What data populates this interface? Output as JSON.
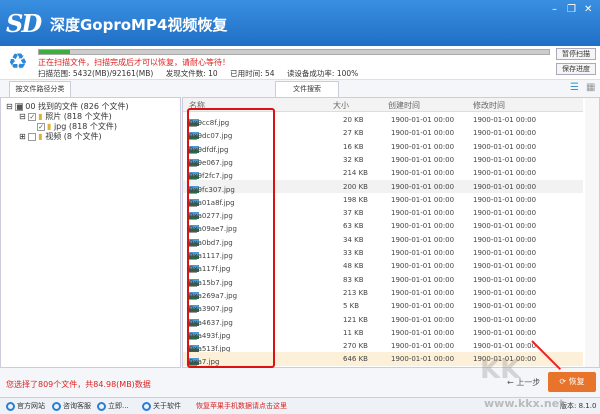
{
  "app": {
    "logo": "SD",
    "title": "深度GoproMP4视频恢复"
  },
  "scan": {
    "progress": 0.06,
    "message": "正在扫描文件，扫描完成后才可以恢复，请耐心等待！",
    "range": "扫描范围: 5432(MB)/92161(MB)",
    "found": "发现文件数: 10",
    "elapsed": "已用时间: 54",
    "success": "读设备成功率: 100%",
    "pause_label": "暂停扫描",
    "save_label": "保存进度"
  },
  "tabs": {
    "by_path": "按文件路径分类",
    "search": "文件搜索"
  },
  "tree": [
    {
      "label": "00 找到的文件",
      "count": "(826 个文件)"
    },
    {
      "label": "照片",
      "count": "(818 个文件)"
    },
    {
      "label": "jpg",
      "count": "(818 个文件)"
    },
    {
      "label": "视频",
      "count": "(8 个文件)"
    }
  ],
  "columns": {
    "name": "名称",
    "size": "大小",
    "created": "创建时间",
    "modified": "修改时间"
  },
  "files": [
    {
      "name": "0x9cc8f.jpg",
      "size": "20 KB",
      "checked": true
    },
    {
      "name": "0x9dc07.jpg",
      "size": "27 KB",
      "checked": true
    },
    {
      "name": "0x9dfdf.jpg",
      "size": "16 KB",
      "checked": true
    },
    {
      "name": "0x9e067.jpg",
      "size": "32 KB",
      "checked": true
    },
    {
      "name": "0x9f2fc7.jpg",
      "size": "214 KB",
      "checked": false
    },
    {
      "name": "0x9fc307.jpg",
      "size": "200 KB",
      "checked": false
    },
    {
      "name": "0xa01a8f.jpg",
      "size": "198 KB",
      "checked": false
    },
    {
      "name": "0xa0277.jpg",
      "size": "37 KB",
      "checked": true
    },
    {
      "name": "0xa09ae7.jpg",
      "size": "63 KB",
      "checked": false
    },
    {
      "name": "0xa0bd7.jpg",
      "size": "34 KB",
      "checked": true
    },
    {
      "name": "0xa1117.jpg",
      "size": "33 KB",
      "checked": true
    },
    {
      "name": "0xa117f.jpg",
      "size": "48 KB",
      "checked": true
    },
    {
      "name": "0xa15b7.jpg",
      "size": "83 KB",
      "checked": true
    },
    {
      "name": "0xa269a7.jpg",
      "size": "213 KB",
      "checked": false
    },
    {
      "name": "0xa3907.jpg",
      "size": "5 KB",
      "checked": true
    },
    {
      "name": "0xa4637.jpg",
      "size": "121 KB",
      "checked": true
    },
    {
      "name": "0xa493f.jpg",
      "size": "11 KB",
      "checked": true
    },
    {
      "name": "0xa513f.jpg",
      "size": "270 KB",
      "checked": true
    },
    {
      "name": "0xa7.jpg",
      "size": "646 KB",
      "checked": true
    }
  ],
  "file_date": "1900-01-01  00:00",
  "bottom": {
    "selection": "您选择了809个文件，共84.98(MB)数据",
    "prev": "上一步",
    "recover": "恢复"
  },
  "status": {
    "site": "官方网站",
    "support": "咨询客服",
    "buy": "立即...",
    "about": "关于软件",
    "apple": "恢复苹果手机数据请点击这里",
    "version": "版本: 8.1.0"
  },
  "watermark": {
    "logo": "KK下载",
    "url": "www.kkx.net"
  }
}
